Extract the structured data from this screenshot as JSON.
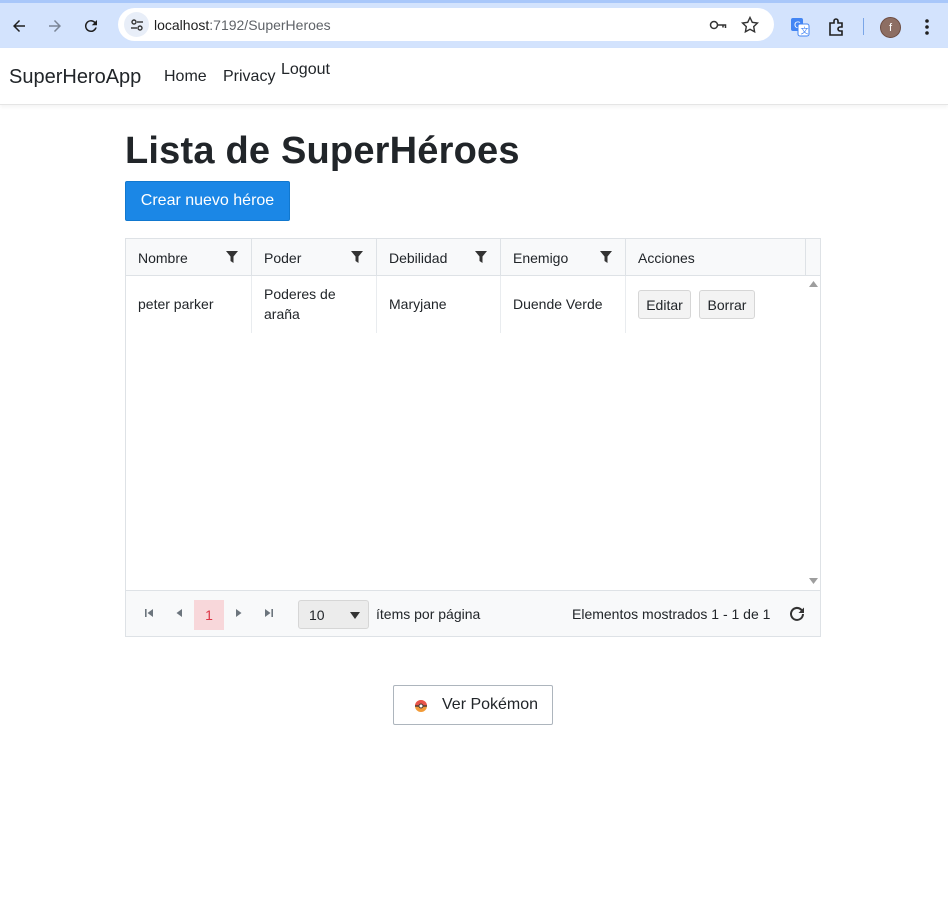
{
  "browser": {
    "url_host": "localhost",
    "url_path": ":7192/SuperHeroes",
    "avatar_letter": "f"
  },
  "navbar": {
    "brand": "SuperHeroApp",
    "links": [
      "Home",
      "Privacy",
      "Logout"
    ]
  },
  "page": {
    "title": "Lista de SuperHéroes",
    "create_button": "Crear nuevo héroe"
  },
  "grid": {
    "columns": [
      "Nombre",
      "Poder",
      "Debilidad",
      "Enemigo",
      "Acciones"
    ],
    "rows": [
      {
        "nombre": "peter parker",
        "poder_line1": "Poderes de",
        "poder_line2": "araña",
        "debilidad": "Maryjane",
        "enemigo": "Duende Verde",
        "edit_label": "Editar",
        "delete_label": "Borrar"
      }
    ],
    "pager": {
      "current_page": "1",
      "page_size": "10",
      "page_size_label": "ítems por página",
      "info": "Elementos mostrados 1 - 1 de 1"
    }
  },
  "pokemon_button": "Ver Pokémon",
  "colors": {
    "primary": "#1b87e6",
    "chrome_bar": "#d3e3fd",
    "active_page_bg": "#f8d7da",
    "active_page_fg": "#dc3545"
  }
}
